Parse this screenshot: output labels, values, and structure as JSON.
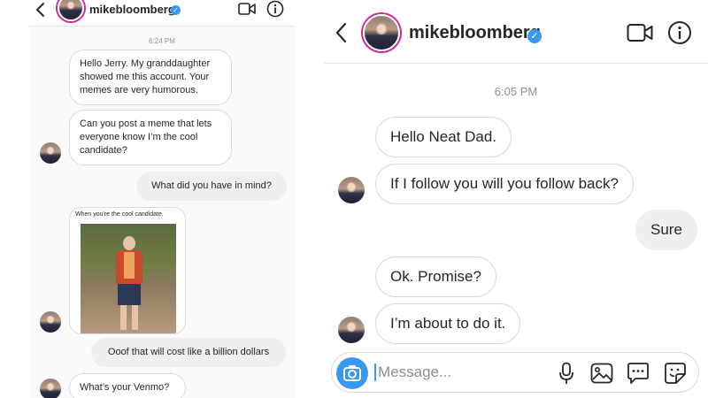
{
  "left": {
    "header": {
      "username": "mikebloomberg",
      "verified": "✓"
    },
    "timestamp": "6:24 PM",
    "messages": [
      {
        "text": "Hello Jerry. My granddaughter showed me this account. Your memes are very humorous."
      },
      {
        "text": "Can you post a meme that lets everyone know I’m the cool candidate?"
      },
      {
        "text": "What did you have in mind?"
      },
      {
        "text": "Ooof that will cost like a billion dollars"
      },
      {
        "text": "What’s your Venmo?"
      }
    ],
    "meme": {
      "caption": "When you're the cool candidate."
    }
  },
  "right": {
    "header": {
      "username": "mikebloomberg",
      "verified": "✓"
    },
    "timestamp": "6:05 PM",
    "messages": [
      {
        "text": "Hello Neat Dad."
      },
      {
        "text": "If I follow you will you follow back?"
      },
      {
        "text": "Sure"
      },
      {
        "text": "Ok. Promise?"
      },
      {
        "text": "I’m about to do it."
      }
    ],
    "input": {
      "placeholder": "Message..."
    }
  },
  "icons": [
    "back-chevron-icon",
    "verified-badge-icon",
    "video-call-icon",
    "info-icon",
    "camera-icon",
    "microphone-icon",
    "gallery-icon",
    "chat-bubble-icon",
    "sticker-icon"
  ],
  "colors": {
    "accent": "#3897f0",
    "bubble_border": "#dbdbdb",
    "my_bubble": "#efefef",
    "text": "#262626",
    "muted": "#8e8e8e"
  }
}
